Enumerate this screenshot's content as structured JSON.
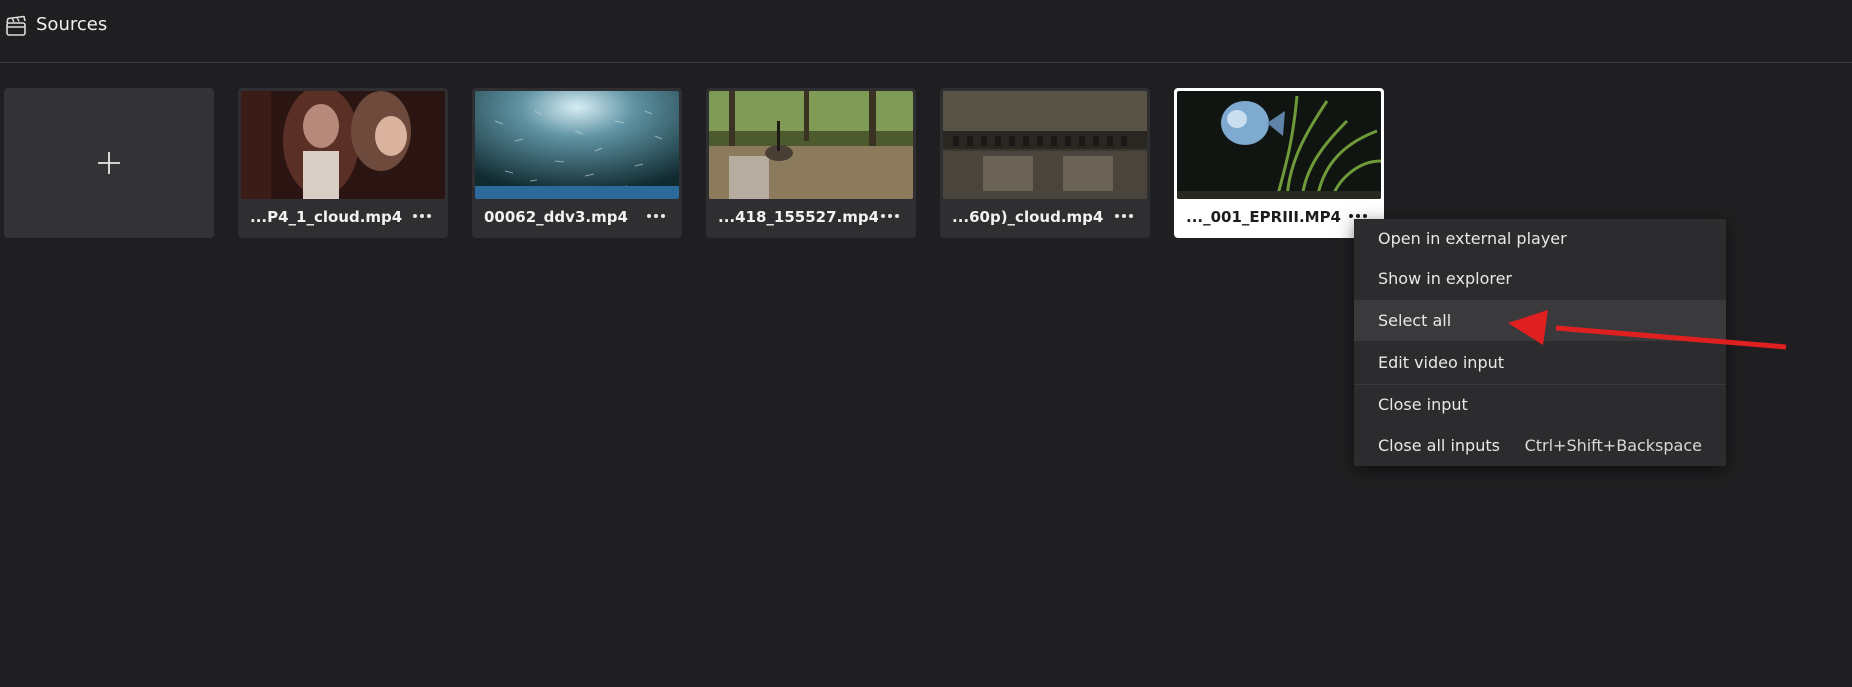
{
  "header": {
    "title": "Sources",
    "icon": "clapperboard-icon"
  },
  "add_tile": {
    "icon": "plus-icon"
  },
  "sources": [
    {
      "name": "...P4_1_cloud.mp4",
      "selected": false
    },
    {
      "name": "00062_ddv3.mp4",
      "selected": false
    },
    {
      "name": "...418_155527.mp4",
      "selected": false
    },
    {
      "name": "...60p)_cloud.mp4",
      "selected": false
    },
    {
      "name": "..._001_EPRIII.MP4",
      "selected": true
    }
  ],
  "context_menu": {
    "items": [
      {
        "label": "Open in external player",
        "shortcut": ""
      },
      {
        "label": "Show in explorer",
        "shortcut": ""
      },
      {
        "label": "Select all",
        "shortcut": "",
        "highlighted": true
      },
      {
        "label": "Edit video input",
        "shortcut": ""
      },
      {
        "label": "Close input",
        "shortcut": ""
      },
      {
        "label": "Close all inputs",
        "shortcut": "Ctrl+Shift+Backspace"
      }
    ]
  },
  "colors": {
    "background": "#1f1f21",
    "menu": "#2c2c2e",
    "arrow": "#e02020"
  }
}
